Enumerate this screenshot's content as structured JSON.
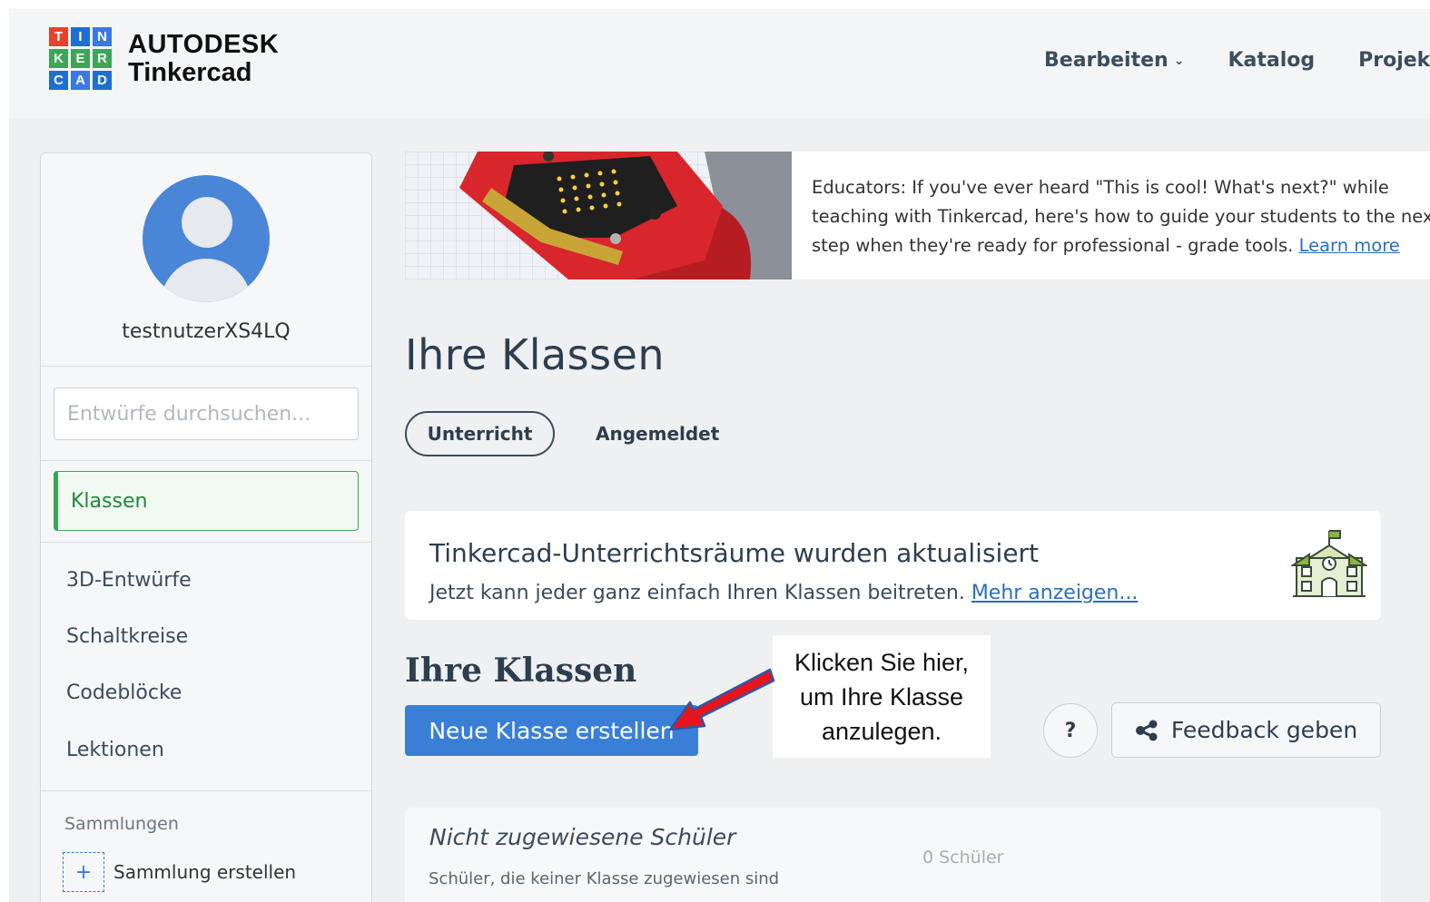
{
  "header": {
    "logo_letters": [
      "T",
      "I",
      "N",
      "K",
      "E",
      "R",
      "C",
      "A",
      "D"
    ],
    "logo_colors": [
      "#e8412c",
      "#1f6fd0",
      "#3b78e7",
      "#3aa657",
      "#3aa657",
      "#3aa657",
      "#1f6fd0",
      "#3b78e7",
      "#1f6fd0"
    ],
    "brand_top": "AUTODESK",
    "brand_bottom": "Tinkercad",
    "nav": [
      {
        "label": "Bearbeiten",
        "has_dropdown": true
      },
      {
        "label": "Katalog",
        "has_dropdown": false
      },
      {
        "label": "Projekt",
        "has_dropdown": false
      }
    ]
  },
  "sidebar": {
    "username": "testnutzerXS4LQ",
    "search_placeholder": "Entwürfe durchsuchen...",
    "active_item": "Klassen",
    "items": [
      "3D-Entwürfe",
      "Schaltkreise",
      "Codeblöcke",
      "Lektionen"
    ],
    "collections_heading": "Sammlungen",
    "create_collection": "Sammlung erstellen"
  },
  "banner": {
    "line1": "Educators: If you've ever heard \"This is cool! What's next?\" while",
    "line2": "teaching with Tinkercad, here's how to guide your students to the next",
    "line3": "step when they're ready for professional - grade tools.",
    "link": "Learn more"
  },
  "main": {
    "title": "Ihre Klassen",
    "tabs": [
      "Unterricht",
      "Angemeldet"
    ],
    "active_tab": "Unterricht",
    "update": {
      "title": "Tinkercad-Unterrichtsräume wurden aktualisiert",
      "text": "Jetzt kann jeder ganz einfach Ihren Klassen beitreten.",
      "link": "Mehr anzeigen..."
    },
    "section_title": "Ihre Klassen",
    "new_class_button": "Neue Klasse erstellen",
    "help_button": "?",
    "feedback_button": "Feedback geben",
    "unassigned": {
      "title": "Nicht zugewiesene Schüler",
      "count": "0 Schüler",
      "subtitle": "Schüler, die keiner Klasse zugewiesen sind"
    }
  },
  "callout": {
    "lines": [
      "Klicken Sie hier,",
      "um Ihre Klasse",
      "anzulegen."
    ],
    "arrow_color": "#e8141d"
  }
}
